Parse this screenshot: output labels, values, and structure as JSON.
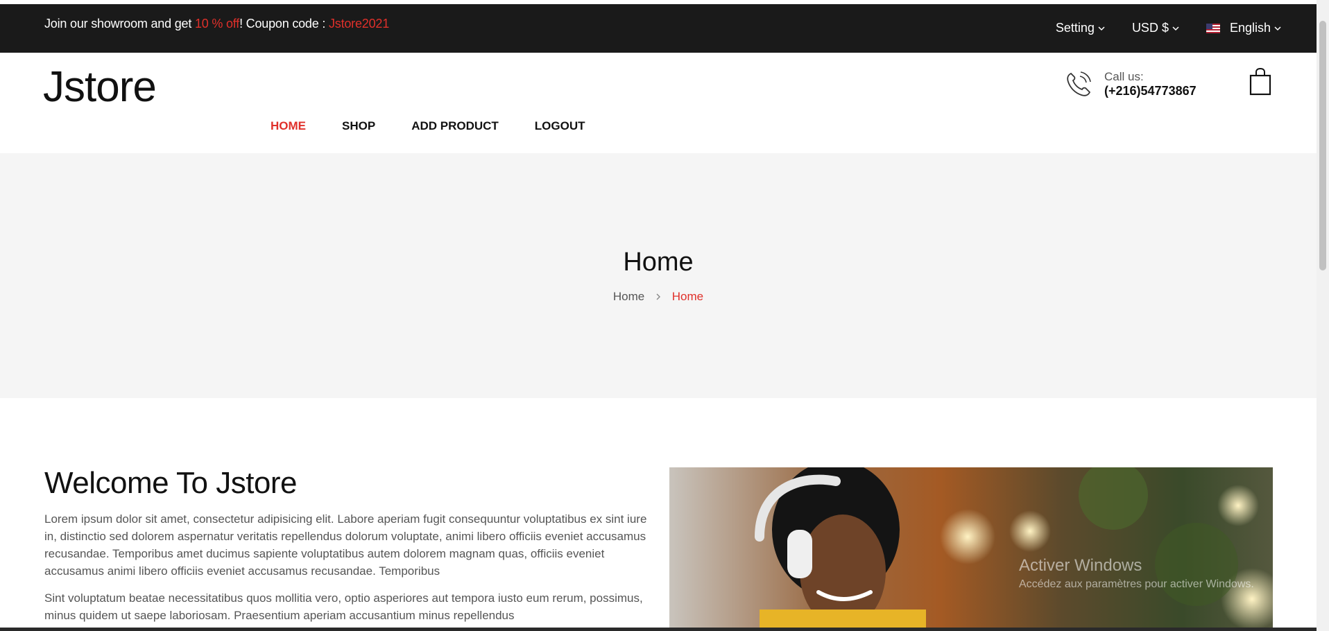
{
  "topbar": {
    "promo_prefix": "Join our showroom and get ",
    "promo_discount": "10 % off",
    "promo_middle": "! Coupon code : ",
    "promo_code": "Jstore2021",
    "setting_label": "Setting",
    "currency_label": "USD $",
    "language_label": "English"
  },
  "header": {
    "logo": "Jstore",
    "nav": [
      "HOME",
      "SHOP",
      "ADD PRODUCT",
      "LOGOUT"
    ],
    "call_label": "Call us:",
    "phone": "(+216)54773867"
  },
  "hero": {
    "title": "Home",
    "breadcrumb_home": "Home",
    "breadcrumb_current": "Home"
  },
  "welcome": {
    "title": "Welcome To Jstore",
    "p1": "Lorem ipsum dolor sit amet, consectetur adipisicing elit. Labore aperiam fugit consequuntur voluptatibus ex sint iure in, distinctio sed dolorem aspernatur veritatis repellendus dolorum voluptate, animi libero officiis eveniet accusamus recusandae. Temporibus amet ducimus sapiente voluptatibus autem dolorem magnam quas, officiis eveniet accusamus animi libero officiis eveniet accusamus recusandae. Temporibus",
    "p2": "Sint voluptatum beatae necessitatibus quos mollitia vero, optio asperiores aut tempora iusto eum rerum, possimus, minus quidem ut saepe laboriosam. Praesentium aperiam accusantium minus repellendus"
  },
  "watermark": {
    "title": "Activer Windows",
    "subtitle": "Accédez aux paramètres pour activer Windows."
  },
  "colors": {
    "accent": "#e0302a",
    "topbar_bg": "#1a1a1a",
    "hero_bg": "#f5f5f5"
  },
  "icons": {
    "setting_chevron": "chevron-down-icon",
    "currency_chevron": "chevron-down-icon",
    "language_flag": "us-flag-icon",
    "phone": "phone-icon",
    "cart": "shopping-bag-icon",
    "breadcrumb_sep": "chevron-right-icon"
  }
}
